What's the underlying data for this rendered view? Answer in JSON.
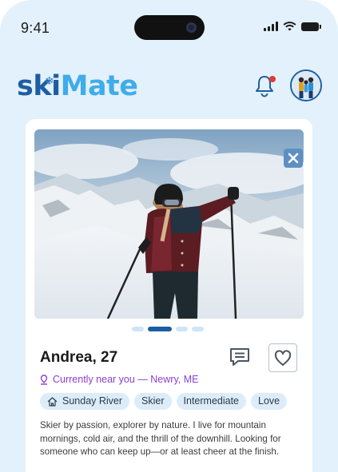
{
  "status_bar": {
    "time": "9:41"
  },
  "header": {
    "logo_part1": "ski",
    "logo_part2": "Mate"
  },
  "profile": {
    "name_age": "Andrea, 27",
    "location": "Currently near you — Newry, ME",
    "photo_count": 4,
    "active_photo_index": 1,
    "tags": [
      {
        "label": "Sunday River",
        "icon": "home-icon"
      },
      {
        "label": "Skier"
      },
      {
        "label": "Intermediate"
      },
      {
        "label": "Love"
      }
    ],
    "bio": "Skier by passion, explorer by nature. I live for mountain mornings, cold air, and the thrill of the downhill. Looking for someone who can keep up—or at least cheer at the finish."
  },
  "colors": {
    "background": "#e3f1fc",
    "brand_dark": "#1d5ea2",
    "brand_light": "#40ace9",
    "location_purple": "#8a3fd0",
    "notification_dot": "#e53935",
    "tag_bg": "#dcedf9"
  }
}
